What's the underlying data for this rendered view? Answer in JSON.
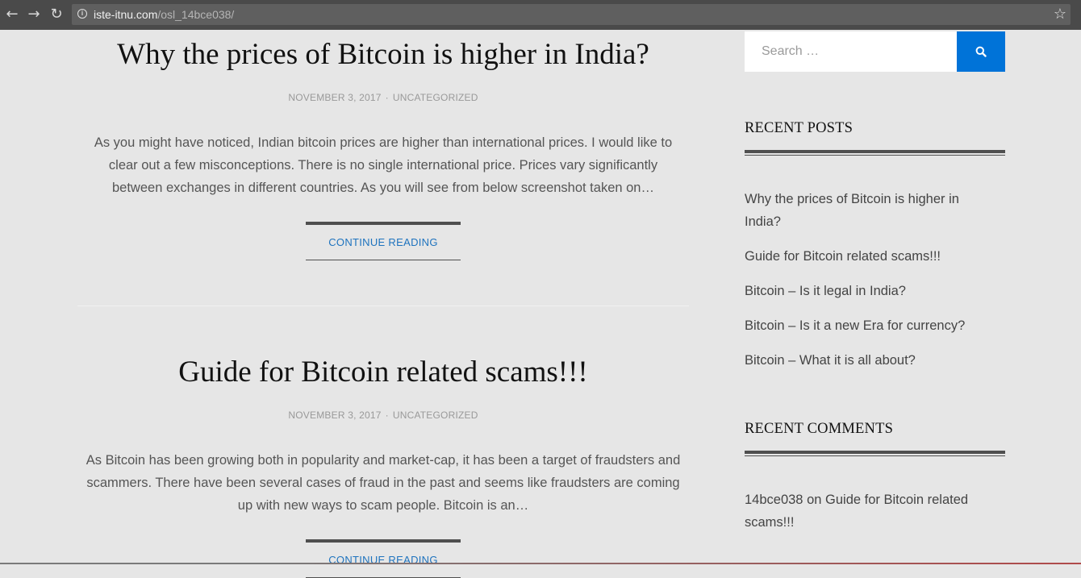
{
  "browser": {
    "url_domain": "iste-itnu.com",
    "url_path": "/osl_14bce038/"
  },
  "posts": [
    {
      "title": "Why the prices of Bitcoin is higher in India?",
      "date": "NOVEMBER 3, 2017",
      "category": "UNCATEGORIZED",
      "excerpt": "As you might have noticed, Indian bitcoin prices are higher than international prices. I would like to clear out a few misconceptions. There is no single international price. Prices vary significantly between exchanges in different countries. As you will see from below screenshot taken on…",
      "continue_label": "CONTINUE READING"
    },
    {
      "title": "Guide for Bitcoin related scams!!!",
      "date": "NOVEMBER 3, 2017",
      "category": "UNCATEGORIZED",
      "excerpt": "As Bitcoin has been growing both in popularity and market-cap, it has been a target of fraudsters and scammers. There have been several cases of fraud in the past and seems like fraudsters are coming up with new ways to scam people. Bitcoin is an…",
      "continue_label": "CONTINUE READING"
    }
  ],
  "sidebar": {
    "search_placeholder": "Search …",
    "recent_posts_title": "RECENT POSTS",
    "recent_posts": [
      "Why the prices of Bitcoin is higher in India?",
      "Guide for Bitcoin related scams!!!",
      "Bitcoin – Is it legal in India?",
      "Bitcoin – Is it a new Era for currency?",
      "Bitcoin – What it is all about?"
    ],
    "recent_comments_title": "RECENT COMMENTS",
    "recent_comment": {
      "author": "14bce038",
      "on": "on",
      "post": "Guide for Bitcoin related scams!!!"
    }
  },
  "colors": {
    "accent": "#1e73be",
    "search_button": "#0073d8",
    "background": "#e6e6e6"
  }
}
